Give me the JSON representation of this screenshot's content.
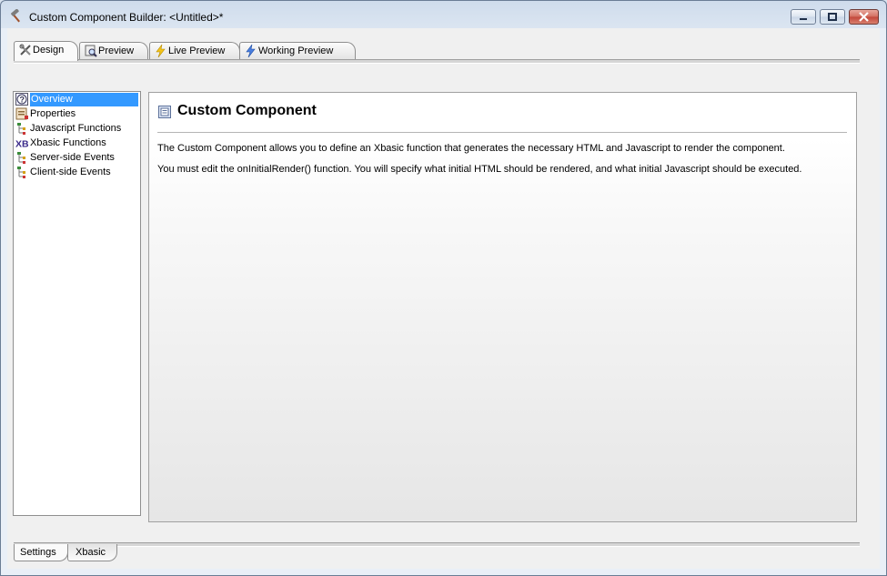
{
  "window": {
    "title": "Custom Component Builder: <Untitled>*",
    "icon": "hammer-icon",
    "controls": {
      "minimize": "minimize-icon",
      "maximize": "maximize-icon",
      "close": "close-icon"
    }
  },
  "top_tabs": [
    {
      "label": "Design",
      "icon": "design-tools-icon",
      "active": true
    },
    {
      "label": "Preview",
      "icon": "preview-magnifier-icon",
      "active": false
    },
    {
      "label": "Live Preview",
      "icon": "lightning-icon",
      "active": false
    },
    {
      "label": "Working Preview",
      "icon": "lightning-blue-icon",
      "active": false
    }
  ],
  "tree": [
    {
      "label": "Overview",
      "icon": "help-icon",
      "selected": true
    },
    {
      "label": "Properties",
      "icon": "properties-icon",
      "selected": false
    },
    {
      "label": "Javascript Functions",
      "icon": "tree-nodes-icon",
      "selected": false
    },
    {
      "label": "Xbasic Functions",
      "icon": "xbasic-icon",
      "selected": false
    },
    {
      "label": "Server-side Events",
      "icon": "tree-nodes-icon",
      "selected": false
    },
    {
      "label": "Client-side Events",
      "icon": "tree-nodes-icon",
      "selected": false
    }
  ],
  "content": {
    "title": "Custom Component",
    "icon": "component-icon",
    "paragraphs": [
      "The Custom Component allows you to define an Xbasic function that generates the necessary HTML and Javascript to render the component.",
      "You must edit the onInitialRender() function. You will specify what initial HTML should be rendered, and what initial Javascript should be executed."
    ]
  },
  "bottom_tabs": [
    {
      "label": "Settings",
      "active": true
    },
    {
      "label": "Xbasic",
      "active": false
    }
  ]
}
